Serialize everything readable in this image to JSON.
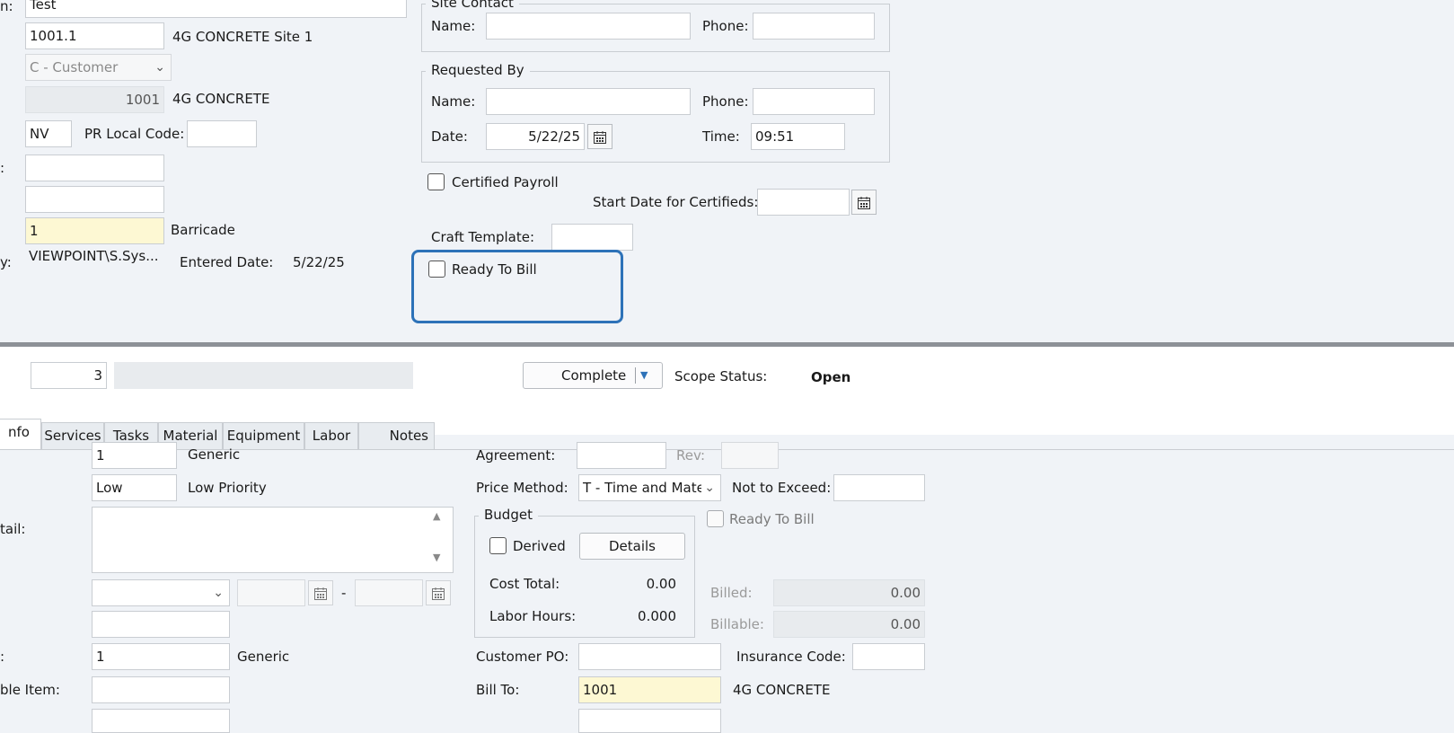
{
  "header": {
    "description_label": "n:",
    "description_value": "Test",
    "site_value": "1001.1",
    "site_name": "4G CONCRETE Site 1",
    "type_value": "C - Customer",
    "customer_number": "1001",
    "customer_name": "4G CONCRETE",
    "state_value": "NV",
    "pr_local_code_label": "PR Local Code:",
    "pr_local_code_value": "",
    "row6_label": ":",
    "row6_value": "",
    "row7_value": "",
    "equip_value": "1",
    "equip_name": "Barricade",
    "entered_by_label": "y:",
    "entered_by_value": "VIEWPOINT\\S.Sys...",
    "entered_date_label": "Entered Date:",
    "entered_date_value": "5/22/25"
  },
  "site_contact": {
    "title": "Site Contact",
    "name_label": "Name:",
    "name_value": "",
    "phone_label": "Phone:",
    "phone_value": ""
  },
  "requested_by": {
    "title": "Requested By",
    "name_label": "Name:",
    "name_value": "",
    "phone_label": "Phone:",
    "phone_value": "",
    "date_label": "Date:",
    "date_value": "5/22/25",
    "time_label": "Time:",
    "time_value": "09:51"
  },
  "certified": {
    "certified_payroll_label": "Certified Payroll",
    "start_date_label": "Start Date for Certifieds:",
    "start_date_value": "",
    "craft_template_label": "Craft Template:",
    "craft_template_value": "",
    "ready_to_bill_label": "Ready To Bill"
  },
  "scope": {
    "scope_number": "3",
    "scope_desc": "",
    "complete_label": "Complete",
    "status_label": "Scope Status:",
    "status_value": "Open"
  },
  "tabs": [
    "nfo",
    "Services",
    "Tasks",
    "Material",
    "Equipment",
    "Labor",
    "Notes"
  ],
  "info": {
    "row1_value": "1",
    "row1_name": "Generic",
    "priority_value": "Low",
    "priority_name": "Low Priority",
    "detail_label": "tail:",
    "detail_value": "",
    "date_sep": "-",
    "row5_value": "",
    "row6_label": ":",
    "row6_value": "1",
    "row6_name": "Generic",
    "billable_item_label": "ble Item:",
    "billable_item_value": ""
  },
  "billing": {
    "agreement_label": "Agreement:",
    "agreement_value": "",
    "rev_label": "Rev:",
    "rev_value": "",
    "price_method_label": "Price Method:",
    "price_method_value": "T - Time and Mater",
    "not_to_exceed_label": "Not to Exceed:",
    "not_to_exceed_value": "",
    "budget_title": "Budget",
    "derived_label": "Derived",
    "details_button": "Details",
    "cost_total_label": "Cost Total:",
    "cost_total_value": "0.00",
    "labor_hours_label": "Labor Hours:",
    "labor_hours_value": "0.000",
    "ready_to_bill_label": "Ready To Bill",
    "billed_label": "Billed:",
    "billed_value": "0.00",
    "billable_label": "Billable:",
    "billable_value": "0.00",
    "customer_po_label": "Customer PO:",
    "customer_po_value": "",
    "insurance_code_label": "Insurance Code:",
    "insurance_code_value": "",
    "bill_to_label": "Bill To:",
    "bill_to_value": "1001",
    "bill_to_name": "4G CONCRETE"
  },
  "colors": {
    "focus_ring": "#2d72b8",
    "required_field": "#fdf8d3",
    "splitter": "#8d9197"
  }
}
